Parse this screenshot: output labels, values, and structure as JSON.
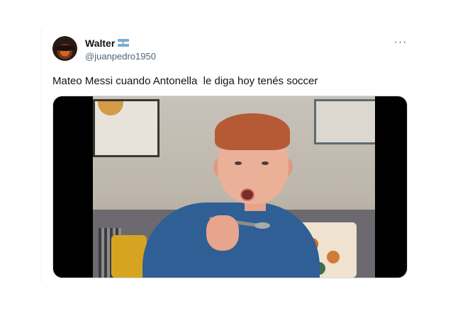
{
  "tweet": {
    "author_name": "Walter",
    "author_handle": "@juanpedro1950",
    "flag_icon": "argentina-flag-icon",
    "more_label": "···",
    "text": "Mateo Messi cuando Antonella  le diga hoy tenés soccer"
  },
  "media": {
    "type": "video-still",
    "description_icon": "boy-eating-spoon-image"
  },
  "colors": {
    "text": "#0f1419",
    "secondary": "#536471",
    "border": "#cfd9de"
  }
}
